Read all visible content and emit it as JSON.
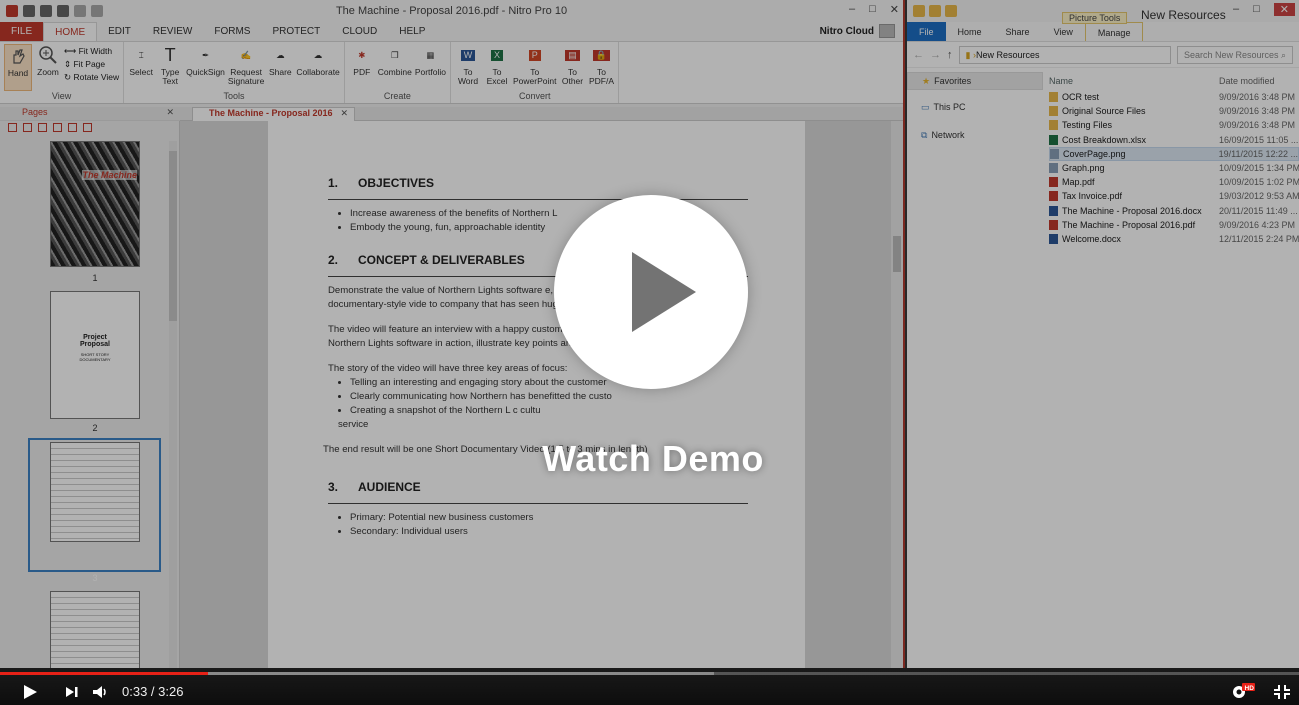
{
  "nitro": {
    "title": "The Machine - Proposal 2016.pdf - Nitro Pro 10",
    "menu_tabs": [
      "FILE",
      "HOME",
      "EDIT",
      "REVIEW",
      "FORMS",
      "PROTECT",
      "CLOUD",
      "HELP"
    ],
    "cloud_label": "Nitro Cloud",
    "ribbon": {
      "view": {
        "label": "View",
        "hand": "Hand",
        "zoom": "Zoom",
        "fit_width": "Fit Width",
        "fit_page": "Fit Page",
        "rotate_view": "Rotate View"
      },
      "tools": {
        "label": "Tools",
        "select": "Select",
        "type_text": "Type\nText",
        "quicksign": "QuickSign",
        "request_signature": "Request\nSignature",
        "share": "Share",
        "collaborate": "Collaborate"
      },
      "create": {
        "label": "Create",
        "pdf": "PDF",
        "combine": "Combine",
        "portfolio": "Portfolio"
      },
      "convert": {
        "label": "Convert",
        "to_word": "To\nWord",
        "to_excel": "To\nExcel",
        "to_powerpoint": "To\nPowerPoint",
        "to_other": "To\nOther",
        "to_pdfa": "To\nPDF/A"
      }
    },
    "pages_panel": {
      "title": "Pages",
      "page_labels": [
        "1",
        "2",
        "3"
      ],
      "cover_text": "The Machine",
      "page2_title": "Project Proposal",
      "page2_sub": "SHORT STORY DOCUMENTARY"
    },
    "doc_tab": "The Machine - Proposal 2016",
    "document": {
      "sections": [
        {
          "num": "1.",
          "heading": "OBJECTIVES"
        },
        {
          "num": "2.",
          "heading": "CONCEPT & DELIVERABLES"
        },
        {
          "num": "3.",
          "heading": "AUDIENCE"
        }
      ],
      "objectives_bullets": [
        "Increase awareness of the benefits of Northern L",
        "Embody the young, fun, approachable identity"
      ],
      "concept_p1": "Demonstrate the value of Northern Lights software e, upb of a successful customer. A documentary-style vide to company that has seen huge benefits from switching",
      "concept_p2": "The video will feature an interview with a happy customer stage of the business, shots of the Northern Lights software in action, illustrate key points and statistics.",
      "concept_p3": "The story of the video will have three key areas of focus:",
      "focus_bullets": [
        "Telling an interesting and engaging story about the customer",
        "Clearly communicating how Northern has benefitted the custo",
        "Creating a snapshot of the Northern L c cultu"
      ],
      "focus_tail": "service",
      "end_result": "The end result will be one Short Documentary Video (1.5 to 3 mins in length)",
      "audience_bullets": [
        "Primary: Potential new business customers",
        "Secondary: Individual users"
      ]
    }
  },
  "explorer": {
    "picture_tools": "Picture Tools",
    "title": "New Resources",
    "menu": [
      "File",
      "Home",
      "Share",
      "View",
      "Manage"
    ],
    "address": "New Resources",
    "search_placeholder": "Search New Resources",
    "nav": [
      "Favorites",
      "This PC",
      "Network"
    ],
    "col_name": "Name",
    "col_date": "Date modified",
    "files": [
      {
        "name": "OCR test",
        "date": "9/09/2016 3:48 PM",
        "kind": "folder"
      },
      {
        "name": "Original Source Files",
        "date": "9/09/2016 3:48 PM",
        "kind": "folder"
      },
      {
        "name": "Testing Files",
        "date": "9/09/2016 3:48 PM",
        "kind": "folder"
      },
      {
        "name": "Cost Breakdown.xlsx",
        "date": "16/09/2015 11:05 ...",
        "kind": "excel"
      },
      {
        "name": "CoverPage.png",
        "date": "19/11/2015 12:22 ...",
        "kind": "image"
      },
      {
        "name": "Graph.png",
        "date": "10/09/2015 1:34 PM",
        "kind": "image"
      },
      {
        "name": "Map.pdf",
        "date": "10/09/2015 1:02 PM",
        "kind": "pdf"
      },
      {
        "name": "Tax Invoice.pdf",
        "date": "19/03/2012 9:53 AM",
        "kind": "pdf"
      },
      {
        "name": "The Machine - Proposal 2016.docx",
        "date": "20/11/2015 11:49 ...",
        "kind": "word"
      },
      {
        "name": "The Machine - Proposal 2016.pdf",
        "date": "9/09/2016 4:23 PM",
        "kind": "pdf"
      },
      {
        "name": "Welcome.docx",
        "date": "12/11/2015 2:24 PM",
        "kind": "word"
      }
    ]
  },
  "overlay": {
    "watch_label": "Watch Demo"
  },
  "player": {
    "time": "0:33 / 3:26",
    "played_fraction": 0.16,
    "buffered_fraction": 0.55,
    "hd_badge": "HD"
  },
  "colors": {
    "nitro_red": "#c0392b",
    "progress_red": "#e62117",
    "explorer_blue": "#1e6fc4"
  }
}
